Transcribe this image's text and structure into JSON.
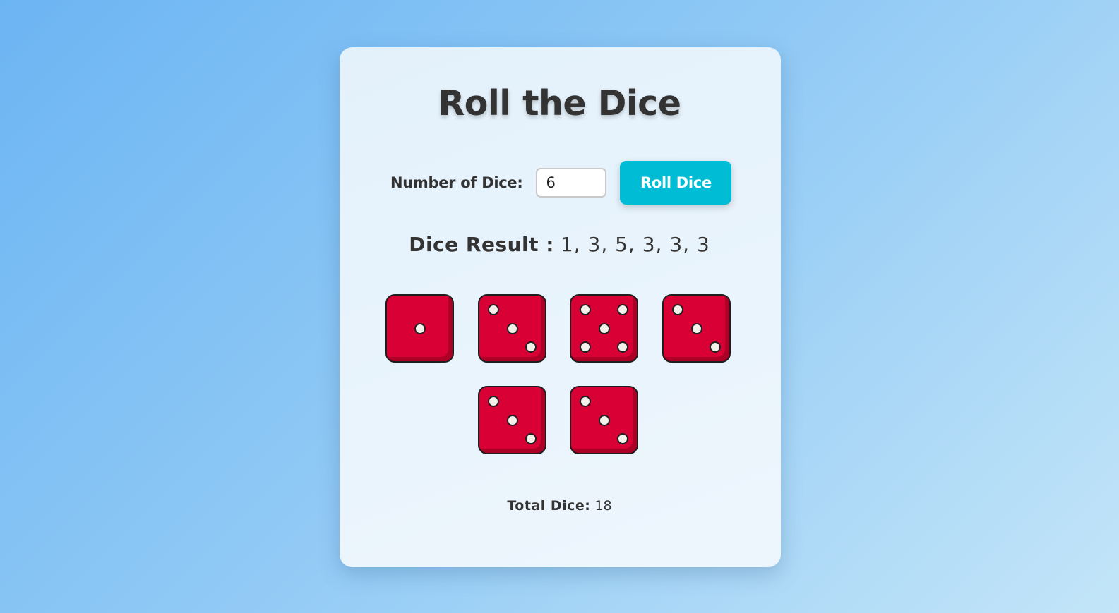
{
  "app": {
    "title": "Roll the Dice"
  },
  "controls": {
    "dice_count_label": "Number of Dice:",
    "dice_count_value": "6",
    "roll_button_label": "Roll Dice"
  },
  "result": {
    "label": "Dice Result :",
    "values_text": "1, 3, 5, 3, 3, 3"
  },
  "dice": [
    1,
    3,
    5,
    3,
    3,
    3
  ],
  "total": {
    "label": "Total Dice:",
    "value": "18"
  },
  "colors": {
    "die_face": "#d90035",
    "pip": "#f4f1ea",
    "button": "#00bcd4"
  }
}
